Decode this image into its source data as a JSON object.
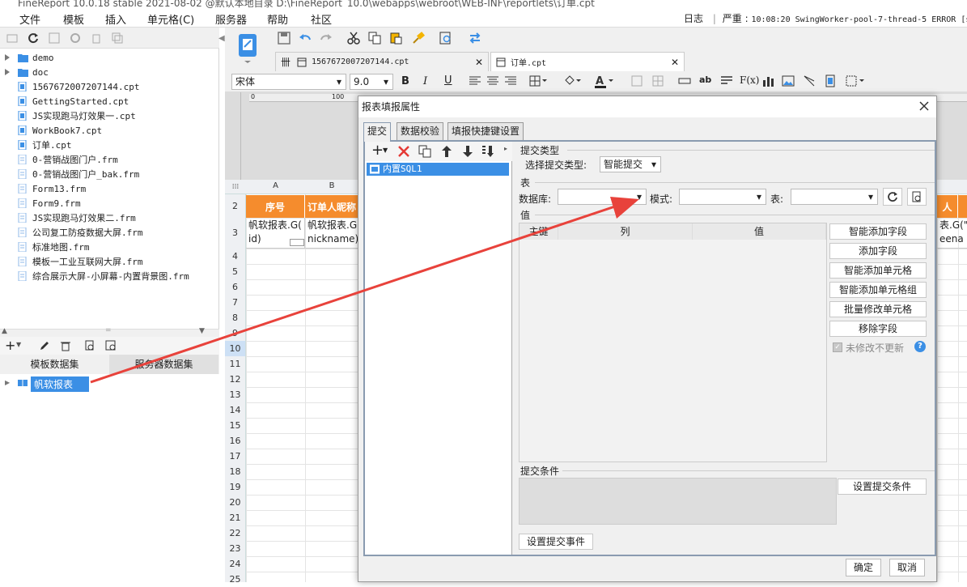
{
  "window": {
    "title": "FineReport 10.0.18 stable 2021-08-02 @默认本地目录    D:\\FineReport_10.0\\webapps\\webroot\\WEB-INF\\reportlets\\订单.cpt"
  },
  "menu": [
    "文件",
    "模板",
    "插入",
    "单元格(C)",
    "服务器",
    "帮助",
    "社区"
  ],
  "log": {
    "label": "日志",
    "level": "严重",
    "message": "10:08:20 SwingWorker-pool-7-thread-5 ERROR [st"
  },
  "tree": [
    {
      "label": "demo",
      "type": "folder",
      "arrow": true
    },
    {
      "label": "doc",
      "type": "folder",
      "arrow": true
    },
    {
      "label": "1567672007207144.cpt",
      "type": "cpt"
    },
    {
      "label": "GettingStarted.cpt",
      "type": "cpt"
    },
    {
      "label": "JS实现跑马灯效果一.cpt",
      "type": "cpt"
    },
    {
      "label": "WorkBook7.cpt",
      "type": "cpt"
    },
    {
      "label": "订单.cpt",
      "type": "cpt"
    },
    {
      "label": "0-营销战图门户.frm",
      "type": "frm"
    },
    {
      "label": "0-营销战图门户_bak.frm",
      "type": "frm"
    },
    {
      "label": "Form13.frm",
      "type": "frm"
    },
    {
      "label": "Form9.frm",
      "type": "frm"
    },
    {
      "label": "JS实现跑马灯效果二.frm",
      "type": "frm"
    },
    {
      "label": "公司复工防疫数据大屏.frm",
      "type": "frm"
    },
    {
      "label": "标准地图.frm",
      "type": "frm"
    },
    {
      "label": "模板一工业互联网大屏.frm",
      "type": "frm"
    },
    {
      "label": "综合展示大屏-小屏幕-内置背景图.frm",
      "type": "frm"
    }
  ],
  "datasets": {
    "tab_template": "模板数据集",
    "tab_server": "服务器数据集",
    "item": "帆软报表"
  },
  "doc_tabs": [
    "1567672007207144.cpt",
    "订单.cpt"
  ],
  "format": {
    "font": "宋体",
    "size": "9.0"
  },
  "ruler": [
    "0",
    "100"
  ],
  "sheet": {
    "columns": [
      "A",
      "B"
    ],
    "rows": [
      "2",
      "3",
      "4",
      "5",
      "6",
      "7",
      "8",
      "9",
      "10",
      "11",
      "12",
      "13",
      "14",
      "15",
      "16",
      "17",
      "18",
      "19",
      "20",
      "21",
      "22",
      "23",
      "24",
      "25"
    ],
    "headers": [
      "序号",
      "订单人昵称"
    ],
    "values": [
      "帆软报表.G(\nid)",
      "帆软报表.G(\nnickname)"
    ],
    "right_header": "人",
    "right_value": "表.G(\"\neena"
  },
  "dialog": {
    "title": "报表填报属性",
    "tabs": [
      "提交",
      "数据校验",
      "填报快捷键设置"
    ],
    "list_item": "内置SQL1",
    "submit_type_section": "提交类型",
    "submit_type_label": "选择提交类型:",
    "submit_type_value": "智能提交",
    "table_section": "表",
    "db_label": "数据库:",
    "schema_label": "模式:",
    "table_label": "表:",
    "value_section": "值",
    "value_columns": [
      "主键",
      "列",
      "值"
    ],
    "buttons": [
      "智能添加字段",
      "添加字段",
      "智能添加单元格",
      "智能添加单元格组",
      "批量修改单元格",
      "移除字段"
    ],
    "unmodified_label": "未修改不更新",
    "condition_section": "提交条件",
    "set_condition": "设置提交条件",
    "set_event": "设置提交事件",
    "ok": "确定",
    "cancel": "取消"
  },
  "colors": {
    "accent": "#3b8fe5",
    "header_fill": "#f58c2d",
    "arrow": "#e8423b"
  }
}
